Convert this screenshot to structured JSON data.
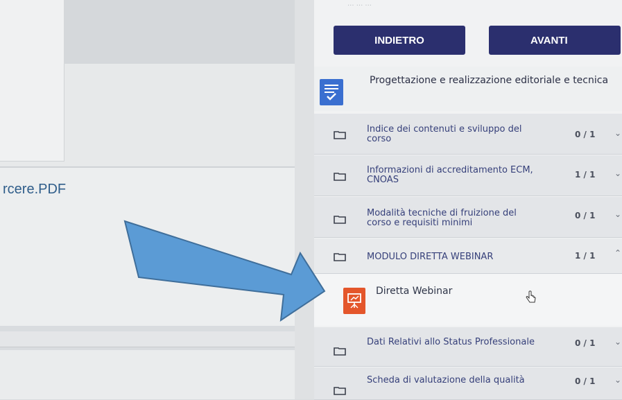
{
  "left": {
    "file_link": "rcere.PDF"
  },
  "sidebar": {
    "top_text": "... ... ...",
    "nav": {
      "back_label": "INDIETRO",
      "next_label": "AVANTI"
    },
    "section": {
      "title": "Progettazione e realizzazione editoriale e tecnica",
      "icon": "document-check-icon"
    },
    "items": [
      {
        "label": "Indice dei contenuti e sviluppo del corso",
        "count": "0 / 1",
        "chevron": "chevron-down"
      },
      {
        "label": "Informazioni di accreditamento ECM, CNOAS",
        "count": "1 / 1",
        "chevron": "chevron-down"
      },
      {
        "label": "Modalità tecniche di fruizione del corso e requisiti minimi",
        "count": "0 / 1",
        "chevron": "chevron-down"
      },
      {
        "label": "MODULO DIRETTA WEBINAR",
        "count": "1 / 1",
        "chevron": "chevron-up"
      },
      {
        "label": "Dati Relativi allo Status Professionale",
        "count": "0 / 1",
        "chevron": "chevron-down"
      },
      {
        "label": "Scheda di valutazione della qualità",
        "count": "0 / 1",
        "chevron": "chevron-down"
      }
    ],
    "subitem": {
      "label": "Diretta Webinar",
      "icon": "presentation-icon"
    }
  },
  "colors": {
    "nav_button": "#2b2f6e",
    "link": "#2f5d8a",
    "item_text": "#36407a",
    "presentation_icon": "#e4562b",
    "doc_icon": "#3a6fd0",
    "arrow": "#5b9bd5"
  }
}
